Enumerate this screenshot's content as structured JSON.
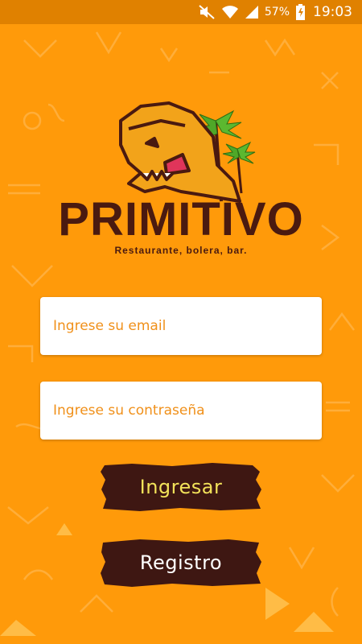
{
  "status_bar": {
    "battery_percent": "57%",
    "time": "19:03",
    "icons": [
      "mute-icon",
      "wifi-icon",
      "signal-icon",
      "battery-charging-icon"
    ]
  },
  "brand": {
    "name": "PRIMITIVO",
    "tagline": "Restaurante, bolera, bar.",
    "colors": {
      "background": "#FF9A0A",
      "text": "#4A1A10",
      "accent": "#F2E25A"
    }
  },
  "form": {
    "email_placeholder": "Ingrese su email",
    "password_placeholder": "Ingrese su contraseña",
    "login_label": "Ingresar",
    "register_label": "Registro"
  }
}
